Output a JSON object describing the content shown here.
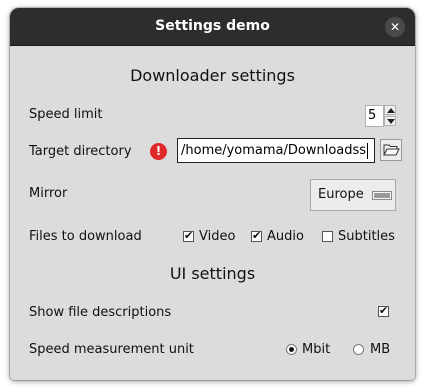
{
  "window": {
    "title": "Settings demo",
    "close_glyph": "✕"
  },
  "downloader": {
    "heading": "Downloader settings",
    "speed_limit": {
      "label": "Speed limit",
      "value": "5"
    },
    "target_directory": {
      "label": "Target directory",
      "warning_glyph": "!",
      "value": "/home/yomama/Downloadss"
    },
    "mirror": {
      "label": "Mirror",
      "selected": "Europe"
    },
    "files": {
      "label": "Files to download",
      "options": [
        {
          "label": "Video",
          "checked": true
        },
        {
          "label": "Audio",
          "checked": true
        },
        {
          "label": "Subtitles",
          "checked": false
        }
      ]
    }
  },
  "ui": {
    "heading": "UI settings",
    "show_descriptions": {
      "label": "Show file descriptions",
      "checked": true
    },
    "speed_unit": {
      "label": "Speed measurement unit",
      "options": [
        {
          "label": "Mbit",
          "selected": true
        },
        {
          "label": "MB",
          "selected": false
        }
      ]
    }
  },
  "icons": {
    "warning": "exclamation-circle-icon",
    "folder": "folder-open-icon",
    "close": "close-icon"
  },
  "colors": {
    "titlebar": "#2d2d2d",
    "window_bg": "#dcdcdc",
    "warning": "#e0282a"
  }
}
